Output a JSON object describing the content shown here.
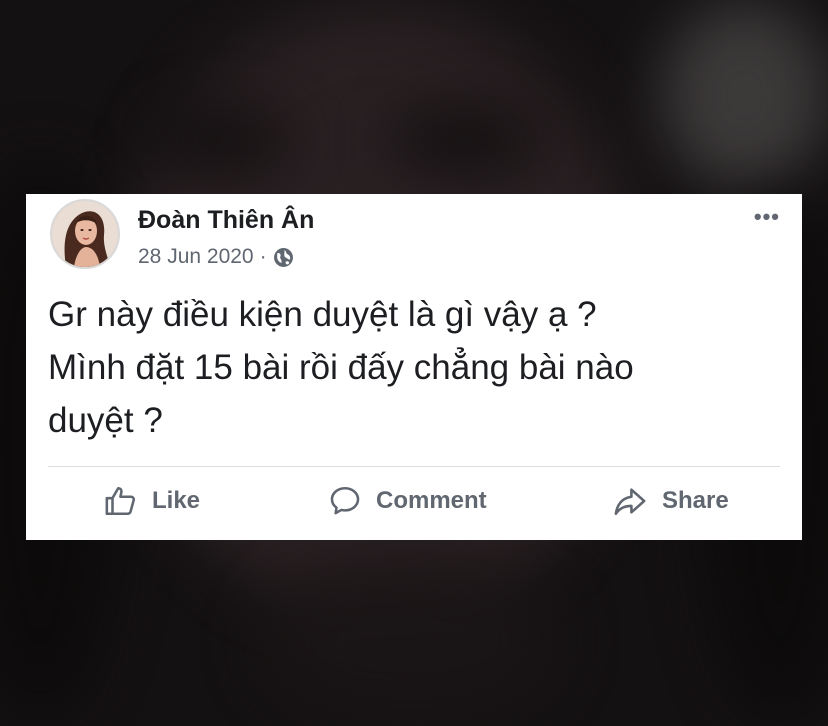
{
  "post": {
    "author": "Đoàn Thiên Ân",
    "date": "28 Jun 2020",
    "separator": "·",
    "privacy_icon": "globe-icon",
    "more_label": "•••",
    "text_lines": [
      "Gr này điều kiện duyệt là gì vậy ạ ?",
      "Mình đặt 15 bài rồi đấy chẳng bài nào",
      "duyệt ?"
    ]
  },
  "actions": {
    "like": {
      "label": "Like",
      "icon": "thumbs-up-icon"
    },
    "comment": {
      "label": "Comment",
      "icon": "comment-icon"
    },
    "share": {
      "label": "Share",
      "icon": "share-arrow-icon"
    }
  },
  "colors": {
    "card_background": "#ffffff",
    "text_primary": "#1c1e21",
    "text_secondary": "#606770",
    "divider": "#dadde1",
    "backdrop": "#141112"
  }
}
